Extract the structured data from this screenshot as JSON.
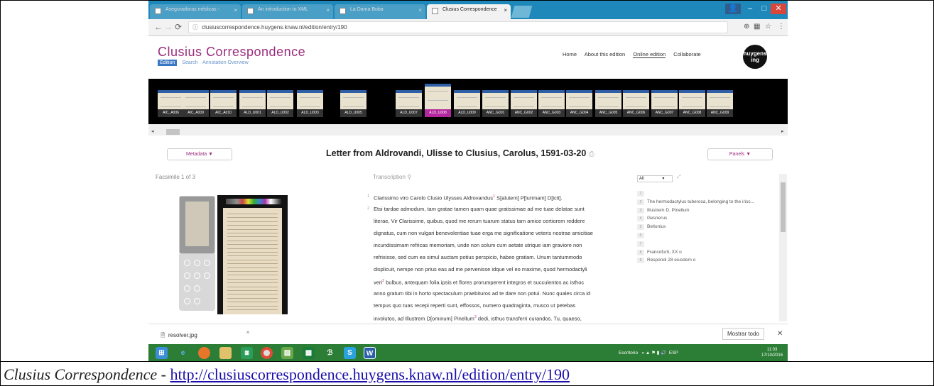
{
  "browser": {
    "tabs": [
      {
        "label": "Aseguradoras médicas -"
      },
      {
        "label": "An introduction to XML"
      },
      {
        "label": "La Dama Boba"
      },
      {
        "label": "Clusius Correspondence"
      }
    ],
    "url": "clusiuscorrespondence.huygens.knaw.nl/edition/entry/190"
  },
  "site": {
    "brand": "Clusius Correspondence",
    "subnav": [
      "Edition",
      "Search",
      "Annotation Overview"
    ],
    "mainnav": [
      "Home",
      "About this edition",
      "Online edition",
      "Collaborate"
    ],
    "logo": "huygens ing"
  },
  "thumbnails": [
    "AIC_A006",
    "AIC_A009",
    "AIC_A010",
    "ALD_U001",
    "ALD_U002",
    "ALD_U003",
    "ALD_U005",
    "ALD_U007",
    "ALD_U008",
    "ALD_U009",
    "ANC_G001",
    "ANC_G002",
    "ANC_G003",
    "ANC_G004",
    "ANC_G005",
    "ANC_G006",
    "ANC_G007",
    "ANC_G008",
    "ANC_G009"
  ],
  "letter": {
    "metadata_btn": "Metadata ▼",
    "panels_btn": "Panels ▼",
    "title": "Letter from Aldrovandi, Ulisse to Clusius, Carolus, 1591-03-20",
    "facsimile_label": "Facsimile 1 of 3",
    "transcription_label": "Transcription",
    "lines": [
      {
        "num": "1",
        "text": "Clarissimo viro Carolo Clusio Ulysses Aldrovandus",
        "fn": "1",
        "after": "  S[alutem] P[lurimam] D[icit]."
      },
      {
        "num": "2",
        "text": "Etsi tardae admodum, tam gratae tamen quam quae gratissimae ad me tuae delatae sunt",
        "fn": "",
        "after": ""
      },
      {
        "num": "",
        "text": "literae, Vir Clarissime, quibus, quod me rerum tuarum status tam amice certiorem reddere",
        "fn": "",
        "after": ""
      },
      {
        "num": "",
        "text": "dignatus, cum non vulgari benevolentiae tuae erga me significatione veteris nostrae amicitiae",
        "fn": "",
        "after": ""
      },
      {
        "num": "",
        "text": "incundissimam refricas memoriam, unde non solum cum aetate utrique iam graviore non",
        "fn": "",
        "after": ""
      },
      {
        "num": "",
        "text": "refrixisse, sed cum ea simul auctam potius perspicio, habeo gratiam. Unum tantummodo",
        "fn": "",
        "after": ""
      },
      {
        "num": "",
        "text": "displicuit, nempe non prius eas ad me pervenisse idque vel eo maxime, quod hermodactyli",
        "fn": "",
        "after": ""
      },
      {
        "num": "",
        "text": "veri",
        "fn": "2",
        "after": "  bulbus, antequam folia ipsis et flores prorumperent integros et succulentos ac isthoc"
      },
      {
        "num": "",
        "text": "anno gratum tibi in horto spectaculum praebituros ad te dare non potui. Nunc quales circa id",
        "fn": "",
        "after": ""
      },
      {
        "num": "",
        "text": "tempus quo tuas recepi reperti sunt, effossos, numero quadraginta, musco ut petebas",
        "fn": "",
        "after": ""
      },
      {
        "num": "",
        "text": "involutos, ad Illustrem D[ominum] Pinellum",
        "fn": "3",
        "after": "  dedi, isthuc transferri curandos. Tu, quaeso,"
      }
    ],
    "notes_filter": "All",
    "notes": [
      {
        "n": "1",
        "text": ""
      },
      {
        "n": "2",
        "text": "The hermodactylus tuberosa, belonging to the irisc..."
      },
      {
        "n": "3",
        "text": "Illustrem D. Pinellum"
      },
      {
        "n": "4",
        "text": "Gesnerus"
      },
      {
        "n": "5",
        "text": "Bellonius"
      },
      {
        "n": "6",
        "text": ""
      },
      {
        "n": "7",
        "text": ""
      },
      {
        "n": "8",
        "text": "Francofurti, XX o"
      },
      {
        "n": "9",
        "text": "Respondi 28 eiusdem o"
      }
    ]
  },
  "download": {
    "file": "resolver.jpg",
    "show_all": "Mostrar todo"
  },
  "taskbar": {
    "tray_label": "Escritorio",
    "lang": "ESP",
    "time": "11:03",
    "date": "17/10/2016"
  },
  "caption": {
    "title": "Clusius Correspondence",
    "sep": " - ",
    "link": "http://clusiuscorrespondence.huygens.knaw.nl/edition/entry/190"
  }
}
